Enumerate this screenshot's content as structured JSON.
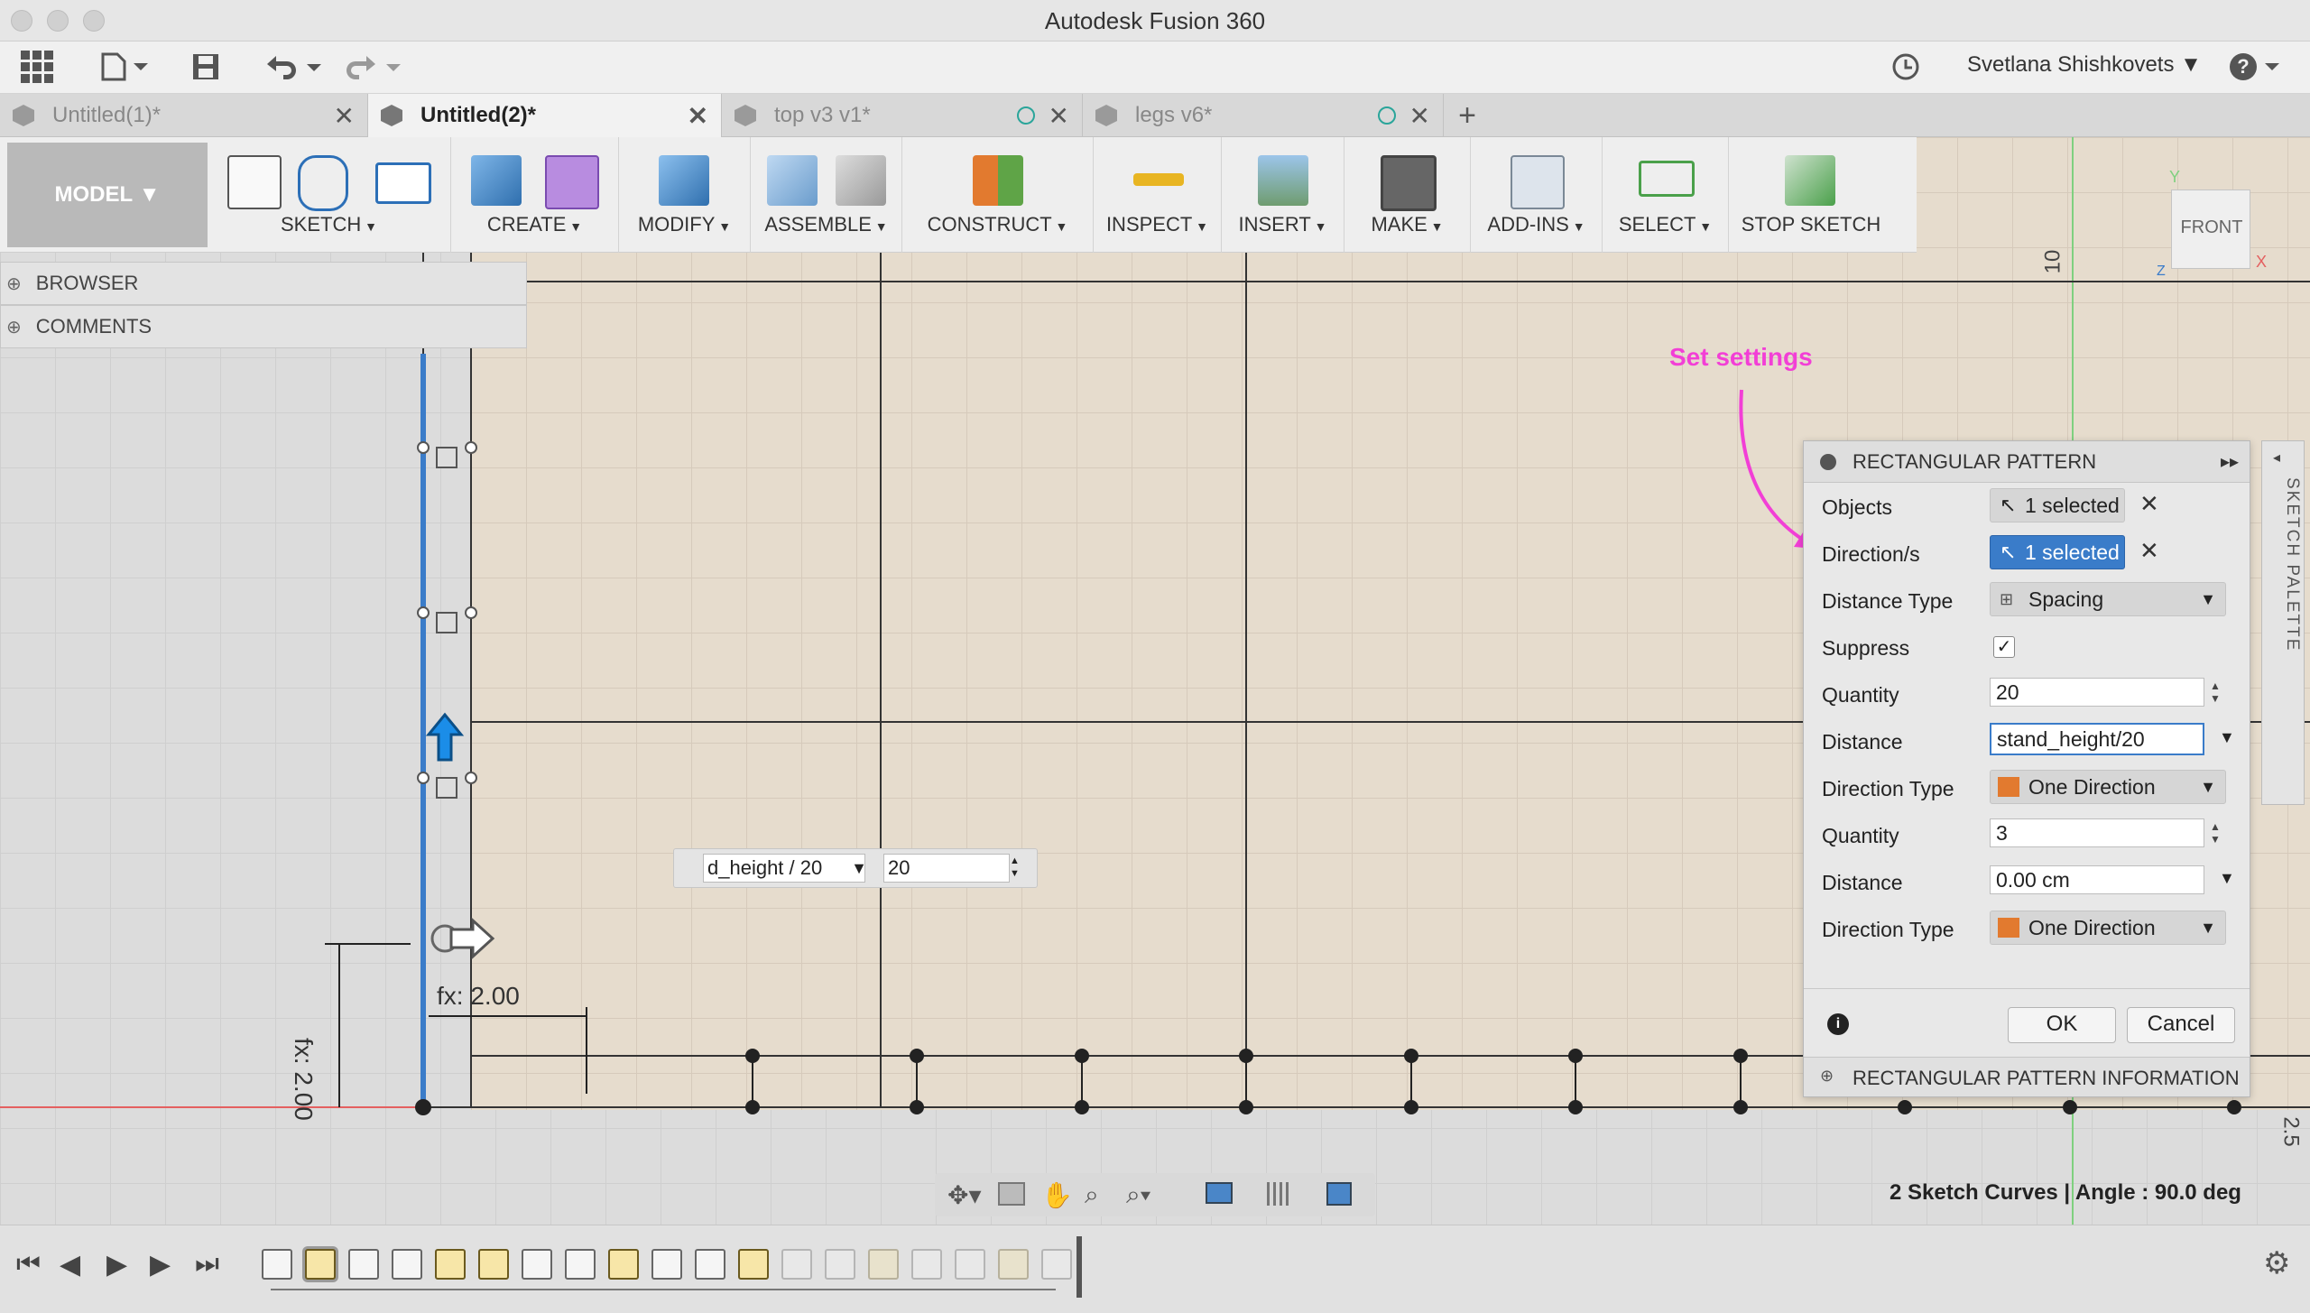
{
  "window": {
    "title": "Autodesk Fusion 360"
  },
  "app_toolbar": {
    "user_name": "Svetlana Shishkovets"
  },
  "doc_tabs": [
    {
      "label": "Untitled(1)*"
    },
    {
      "label": "Untitled(2)*"
    },
    {
      "label": "top v3 v1*"
    },
    {
      "label": "legs v6*"
    }
  ],
  "ribbon": {
    "workspace": "MODEL",
    "groups": [
      {
        "label": "SKETCH"
      },
      {
        "label": "CREATE"
      },
      {
        "label": "MODIFY"
      },
      {
        "label": "ASSEMBLE"
      },
      {
        "label": "CONSTRUCT"
      },
      {
        "label": "INSPECT"
      },
      {
        "label": "INSERT"
      },
      {
        "label": "MAKE"
      },
      {
        "label": "ADD-INS"
      },
      {
        "label": "SELECT"
      },
      {
        "label": "STOP SKETCH"
      }
    ]
  },
  "panels": {
    "browser": "BROWSER",
    "comments": "COMMENTS"
  },
  "viewcube": {
    "face": "FRONT",
    "axis_y": "Y",
    "axis_x": "X",
    "axis_z": "Z"
  },
  "canvas": {
    "ruler_top": "10",
    "ruler_right": "2.5",
    "dim_horizontal": "fx: 2.00",
    "dim_vertical": "fx: 2.00",
    "annotation": "Set settings",
    "inline_edit": {
      "expression": "d_height / 20",
      "quantity": "20"
    }
  },
  "dialog": {
    "title": "RECTANGULAR PATTERN",
    "rows": {
      "objects": {
        "label": "Objects",
        "value": "1 selected"
      },
      "directions": {
        "label": "Direction/s",
        "value": "1 selected"
      },
      "distance_type": {
        "label": "Distance Type",
        "value": "Spacing"
      },
      "suppress": {
        "label": "Suppress",
        "checked": true
      },
      "quantity1": {
        "label": "Quantity",
        "value": "20"
      },
      "distance1": {
        "label": "Distance",
        "value": "stand_height/20"
      },
      "direction_type1": {
        "label": "Direction Type",
        "value": "One Direction"
      },
      "quantity2": {
        "label": "Quantity",
        "value": "3"
      },
      "distance2": {
        "label": "Distance",
        "value": "0.00 cm"
      },
      "direction_type2": {
        "label": "Direction Type",
        "value": "One Direction"
      }
    },
    "ok": "OK",
    "cancel": "Cancel",
    "info_section": "RECTANGULAR PATTERN INFORMATION"
  },
  "palette": {
    "label": "SKETCH PALETTE"
  },
  "status": {
    "text": "2 Sketch Curves | Angle : 90.0 deg"
  },
  "colors": {
    "accent_blue": "#3a7cc9",
    "sketch_bg": "#e6dccd",
    "annotation": "#f23fd6"
  }
}
